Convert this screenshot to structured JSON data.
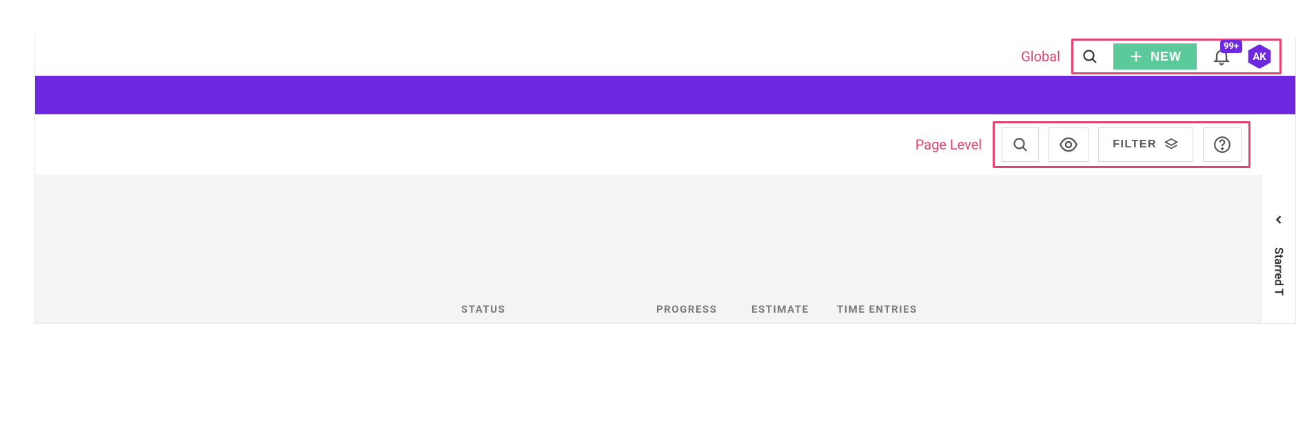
{
  "global": {
    "label": "Global",
    "new_button": "NEW",
    "notification_count": "99+",
    "avatar_initials": "AK"
  },
  "page_level": {
    "label": "Page Level",
    "filter_button": "FILTER"
  },
  "sidebar": {
    "starred_label": "Starred T"
  },
  "columns": {
    "status": "STATUS",
    "progress": "PROGRESS",
    "estimate": "ESTIMATE",
    "time_entries": "TIME ENTRIES"
  },
  "colors": {
    "accent_purple": "#6e28e0",
    "highlight_pink": "#e5436f",
    "button_green": "#5cc99a"
  }
}
